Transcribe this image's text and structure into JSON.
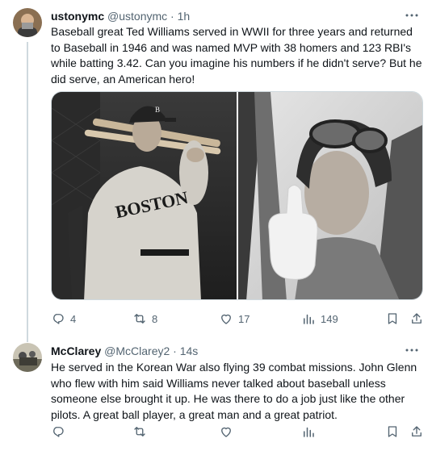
{
  "post1": {
    "display_name": "ustonymc",
    "handle": "@ustonymc",
    "separator": "·",
    "time": "1h",
    "text": "Baseball great Ted Williams served in WWII for three years and returned to Baseball in 1946 and was named MVP with 38 homers and 123 RBI's while batting 3.42. Can you imagine his numbers if he didn't serve? But he did serve, an American hero!",
    "images": [
      "Ted Williams in Boston baseball uniform",
      "Ted Williams in flight helmet giving thumbs up"
    ],
    "jersey_text": "BOSTON",
    "cap_letter": "B",
    "actions": {
      "replies": "4",
      "reposts": "8",
      "likes": "17",
      "views": "149"
    }
  },
  "post2": {
    "display_name": "McClarey",
    "handle": "@McClarey2",
    "separator": "·",
    "time": "14s",
    "text": "He served in the Korean War also flying 39 combat missions.  John Glenn who flew with him said Williams never talked about baseball unless someone else brought it up.  He was there to do a job just like the other pilots.  A great ball player, a great man and a great patriot.",
    "actions": {
      "replies": "",
      "reposts": "",
      "likes": "",
      "views": ""
    }
  },
  "icons": [
    "more-icon",
    "reply-icon",
    "repost-icon",
    "like-icon",
    "views-icon",
    "bookmark-icon",
    "share-icon"
  ],
  "colors": {
    "text": "#0f1419",
    "secondary": "#536471",
    "border": "#cfd9de"
  }
}
